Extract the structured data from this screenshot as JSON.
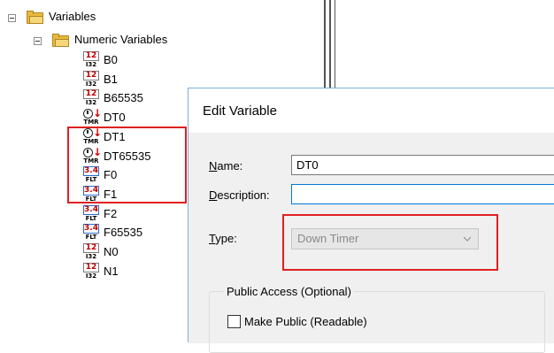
{
  "tree": {
    "root_label": "Variables",
    "group_label": "Numeric Variables",
    "items": [
      {
        "icon": "integer-icon",
        "badge_top": "12",
        "badge_bottom": "I32",
        "label": "B0"
      },
      {
        "icon": "integer-icon",
        "badge_top": "12",
        "badge_bottom": "I32",
        "label": "B1"
      },
      {
        "icon": "integer-icon",
        "badge_top": "12",
        "badge_bottom": "I32",
        "label": "B65535"
      },
      {
        "icon": "down-timer-icon",
        "badge_top": "↓",
        "badge_bottom": "TMR",
        "label": "DT0"
      },
      {
        "icon": "down-timer-icon",
        "badge_top": "↓",
        "badge_bottom": "TMR",
        "label": "DT1"
      },
      {
        "icon": "down-timer-icon",
        "badge_top": "↓",
        "badge_bottom": "TMR",
        "label": "DT65535"
      },
      {
        "icon": "float-icon",
        "badge_top": "3.4",
        "badge_bottom": "FLT",
        "label": "F0"
      },
      {
        "icon": "float-icon",
        "badge_top": "3.4",
        "badge_bottom": "FLT",
        "label": "F1"
      },
      {
        "icon": "float-icon",
        "badge_top": "3.4",
        "badge_bottom": "FLT",
        "label": "F2"
      },
      {
        "icon": "float-icon",
        "badge_top": "3.4",
        "badge_bottom": "FLT",
        "label": "F65535"
      },
      {
        "icon": "integer-icon",
        "badge_top": "12",
        "badge_bottom": "I32",
        "label": "N0"
      },
      {
        "icon": "integer-icon",
        "badge_top": "12",
        "badge_bottom": "I32",
        "label": "N1"
      }
    ]
  },
  "dialog": {
    "title": "Edit Variable",
    "name_label_key": "N",
    "name_label_rest": "ame:",
    "name_value": "DT0",
    "description_label_key": "D",
    "description_label_rest": "escription:",
    "description_value": "",
    "type_label_key": "T",
    "type_label_rest": "ype:",
    "type_value": "Down Timer",
    "public_access_caption": "Public Access (Optional)",
    "make_public_label": "Make Public (Readable)",
    "make_public_checked": false
  },
  "colors": {
    "highlight": "#e02020",
    "dialog_border": "#7eaedb",
    "integer_badge": "#c00000",
    "timer_arrow": "#d40000",
    "folder": "#e8b93c"
  }
}
